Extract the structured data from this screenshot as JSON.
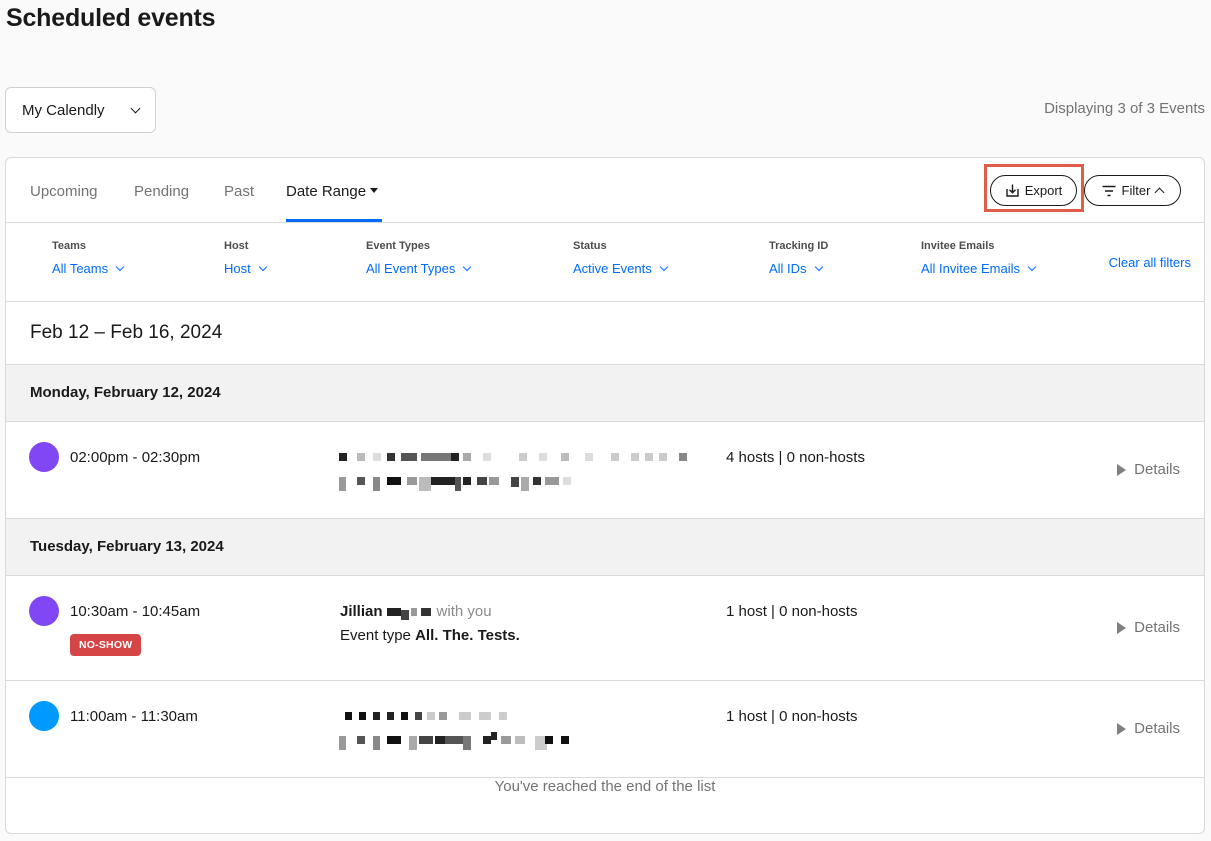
{
  "page": {
    "title": "Scheduled events"
  },
  "calendar_select": {
    "value": "My Calendly"
  },
  "summary": {
    "displaying": "Displaying 3 of 3 Events"
  },
  "tabs": [
    {
      "label": "Upcoming",
      "active": false
    },
    {
      "label": "Pending",
      "active": false
    },
    {
      "label": "Past",
      "active": false
    },
    {
      "label": "Date Range",
      "active": true
    }
  ],
  "actions": {
    "export_label": "Export",
    "filter_label": "Filter"
  },
  "filters": [
    {
      "label": "Teams",
      "value": "All Teams"
    },
    {
      "label": "Host",
      "value": "Host"
    },
    {
      "label": "Event Types",
      "value": "All Event Types"
    },
    {
      "label": "Status",
      "value": "Active Events"
    },
    {
      "label": "Tracking ID",
      "value": "All IDs"
    },
    {
      "label": "Invitee Emails",
      "value": "All Invitee Emails"
    }
  ],
  "clear_filters_label": "Clear all filters",
  "date_range": "Feb 12 – Feb 16, 2024",
  "days": [
    {
      "heading": "Monday, February 12, 2024",
      "events": [
        {
          "time": "02:00pm - 02:30pm",
          "hosts": "4 hosts | 0 non-hosts",
          "details_label": "Details",
          "color": "#8247f5"
        }
      ]
    },
    {
      "heading": "Tuesday, February 13, 2024",
      "events": [
        {
          "time": "10:30am - 10:45am",
          "badge": "NO-SHOW",
          "invitee_first_name": "Jillian",
          "invitee_suffix": "with you",
          "event_type_prefix": "Event type",
          "event_type_name": "All. The. Tests.",
          "hosts": "1 host | 0 non-hosts",
          "details_label": "Details",
          "color": "#8247f5"
        },
        {
          "time": "11:00am - 11:30am",
          "hosts": "1 host | 0 non-hosts",
          "details_label": "Details",
          "color": "#0099ff"
        }
      ]
    }
  ],
  "end_message": "You've reached the end of the list",
  "colors": {
    "accent": "#006bff",
    "highlight": "#e25c4a",
    "badge": "#d64545"
  }
}
